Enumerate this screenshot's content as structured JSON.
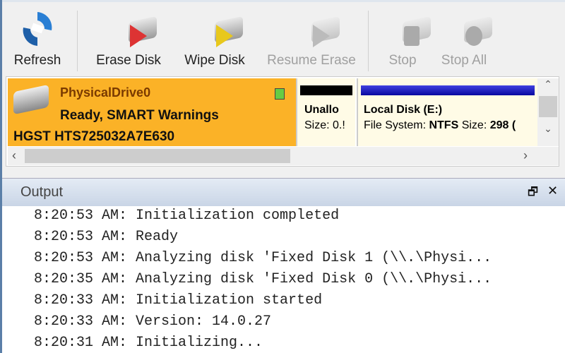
{
  "toolbar": {
    "buttons": [
      {
        "label": "Refresh",
        "enabled": true
      },
      {
        "label": "Erase Disk",
        "enabled": true
      },
      {
        "label": "Wipe Disk",
        "enabled": true
      },
      {
        "label": "Resume Erase",
        "enabled": false
      },
      {
        "label": "Stop",
        "enabled": false
      },
      {
        "label": "Stop All",
        "enabled": false
      }
    ]
  },
  "drive": {
    "name": "PhysicalDrive0",
    "status": "Ready, SMART Warnings",
    "model": "HGST HTS725032A7E630",
    "highlight": "#fbb227"
  },
  "partitions": [
    {
      "name": "Unallo",
      "size_label": "Size:",
      "size": "0.!",
      "bar": "#000000"
    },
    {
      "name": "Local Disk (E:)",
      "fs_label": "File System:",
      "fs": "NTFS",
      "size_label": "Size:",
      "size": "298 (",
      "bar": "#1010c8"
    }
  ],
  "output": {
    "title": "Output",
    "lines": [
      "8:20:53 AM: Initialization completed",
      "8:20:53 AM: Ready",
      "8:20:53 AM: Analyzing disk 'Fixed Disk 1 (\\\\.\\Physi...",
      "8:20:35 AM: Analyzing disk 'Fixed Disk 0 (\\\\.\\Physi...",
      "8:20:33 AM: Initialization started",
      "8:20:33 AM: Version: 14.0.27",
      "8:20:31 AM: Initializing..."
    ]
  }
}
